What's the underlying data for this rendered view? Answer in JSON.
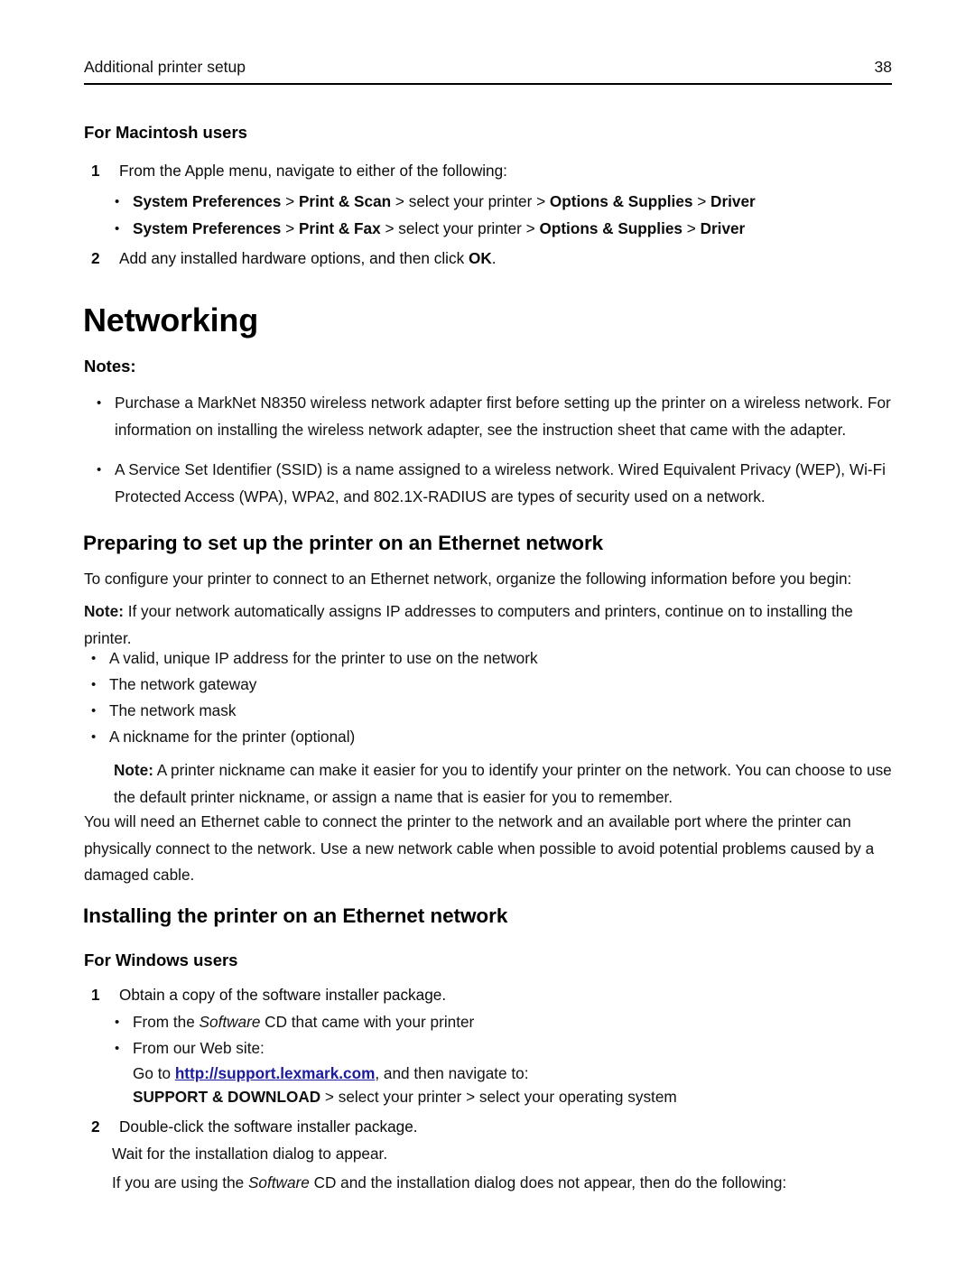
{
  "header": {
    "chapter": "Additional printer setup",
    "page_number": "38",
    "rule_color": "#000000"
  },
  "link_color": "#1b1b9e",
  "sections": {
    "mac": {
      "heading": "For Macintosh users",
      "step1": {
        "number": "1",
        "text": "From the Apple menu, navigate to either of the following:"
      },
      "bullets": [
        {
          "bold1": "System Preferences",
          "sep1": " > ",
          "bold2": "Print & Scan",
          "mid": " > select your printer > ",
          "bold3": "Options & Supplies",
          "sep2": " > ",
          "bold4": "Driver"
        },
        {
          "bold1": "System Preferences",
          "sep1": " > ",
          "bold2": "Print & Fax",
          "mid": " > select your printer > ",
          "bold3": "Options & Supplies",
          "sep2": " > ",
          "bold4": "Driver"
        }
      ],
      "step2": {
        "number": "2",
        "pre": "Add any installed hardware options, and then click ",
        "bold": "OK",
        "post": "."
      }
    },
    "networking": {
      "heading": "Networking",
      "notes_label": "Notes:",
      "notes": [
        "Purchase a MarkNet N8350 wireless network adapter first before setting up the printer on a wireless network. For information on installing the wireless network adapter, see the instruction sheet that came with the adapter.",
        "A Service Set Identifier (SSID) is a name assigned to a wireless network. Wired Equivalent Privacy (WEP), Wi-Fi Protected Access (WPA), WPA2, and 802.1X-RADIUS are types of security used on a network."
      ]
    },
    "preparing": {
      "heading": "Preparing to set up the printer on an Ethernet network",
      "intro": "To configure your printer to connect to an Ethernet network, organize the following information before you begin:",
      "note1": {
        "label": "Note:",
        "text": " If your network automatically assigns IP addresses to computers and printers, continue on to installing the printer."
      },
      "requirements": [
        "A valid, unique IP address for the printer to use on the network",
        "The network gateway",
        "The network mask",
        "A nickname for the printer (optional)"
      ],
      "note2": {
        "label": "Note:",
        "text": " A printer nickname can make it easier for you to identify your printer on the network. You can choose to use the default printer nickname, or assign a name that is easier for you to remember."
      },
      "cable_paragraph": "You will need an Ethernet cable to connect the printer to the network and an available port where the printer can physically connect to the network. Use a new network cable when possible to avoid potential problems caused by a damaged cable."
    },
    "installing": {
      "heading": "Installing the printer on an Ethernet network",
      "windows_heading": "For Windows users",
      "step1": {
        "number": "1",
        "text": "Obtain a copy of the software installer package."
      },
      "step1_bullets": {
        "cd": {
          "pre": "From the ",
          "italic": "Software",
          "post": " CD that came with your printer"
        },
        "web": "From our Web site:",
        "goto_pre": "Go to ",
        "url": "http://support.lexmark.com",
        "goto_post": ", and then navigate to:",
        "path_bold": "SUPPORT & DOWNLOAD",
        "path_rest": " > select your printer > select your operating system"
      },
      "step2": {
        "number": "2",
        "text": "Double-click the software installer package."
      },
      "step2_wait": "Wait for the installation dialog to appear.",
      "step2_if": {
        "pre": "If you are using the ",
        "italic": "Software",
        "post": " CD and the installation dialog does not appear, then do the following:"
      }
    }
  }
}
